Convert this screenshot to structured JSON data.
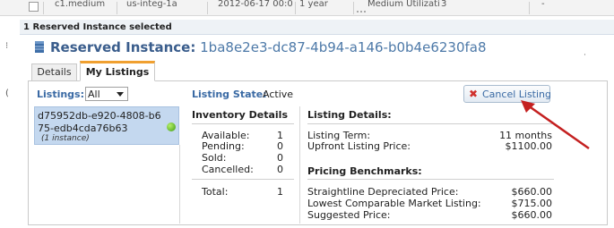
{
  "table_row": {
    "cells": [
      "c1.medium",
      "us-integ-1a",
      "2012-06-17 00:0",
      "1 year",
      "Medium Utilizati",
      "3",
      "-"
    ]
  },
  "selection_header": "1 Reserved Instance selected",
  "title": {
    "prefix": "Reserved Instance:",
    "id": "1ba8e2e3-dc87-4b94-a146-b0b4e6230fa8"
  },
  "tabs": [
    {
      "label": "Details",
      "active": false
    },
    {
      "label": "My Listings",
      "active": true
    }
  ],
  "listings_filter": {
    "label": "Listings:",
    "selected": "All"
  },
  "listing_item": {
    "id": "d75952db-e920-4808-b675-edb4cda76b63",
    "subtitle": "(1 instance)",
    "status_color": "#3d9b12"
  },
  "listing_state": {
    "label": "Listing State:",
    "value": "Active"
  },
  "cancel_button": {
    "label": "Cancel Listing",
    "icon": "close-icon"
  },
  "inventory": {
    "title": "Inventory Details",
    "rows": [
      {
        "label": "Available:",
        "value": "1"
      },
      {
        "label": "Pending:",
        "value": "0"
      },
      {
        "label": "Sold:",
        "value": "0"
      },
      {
        "label": "Cancelled:",
        "value": "0"
      }
    ],
    "total": {
      "label": "Total:",
      "value": "1"
    }
  },
  "listing_details": {
    "title": "Listing Details:",
    "rows": [
      {
        "label": "Listing Term:",
        "value": "11 months"
      },
      {
        "label": "Upfront Listing Price:",
        "value": "$1100.00"
      }
    ]
  },
  "pricing_benchmarks": {
    "title": "Pricing Benchmarks:",
    "rows": [
      {
        "label": "Straightline Depreciated Price:",
        "value": "$660.00"
      },
      {
        "label": "Lowest Comparable Market Listing:",
        "value": "$715.00"
      },
      {
        "label": "Suggested Price:",
        "value": "$660.00"
      }
    ]
  },
  "colors": {
    "accent_blue": "#3a6aa4",
    "tab_active": "#f0a030",
    "cancel_icon": "#d0312d",
    "arrow": "#c42020"
  }
}
